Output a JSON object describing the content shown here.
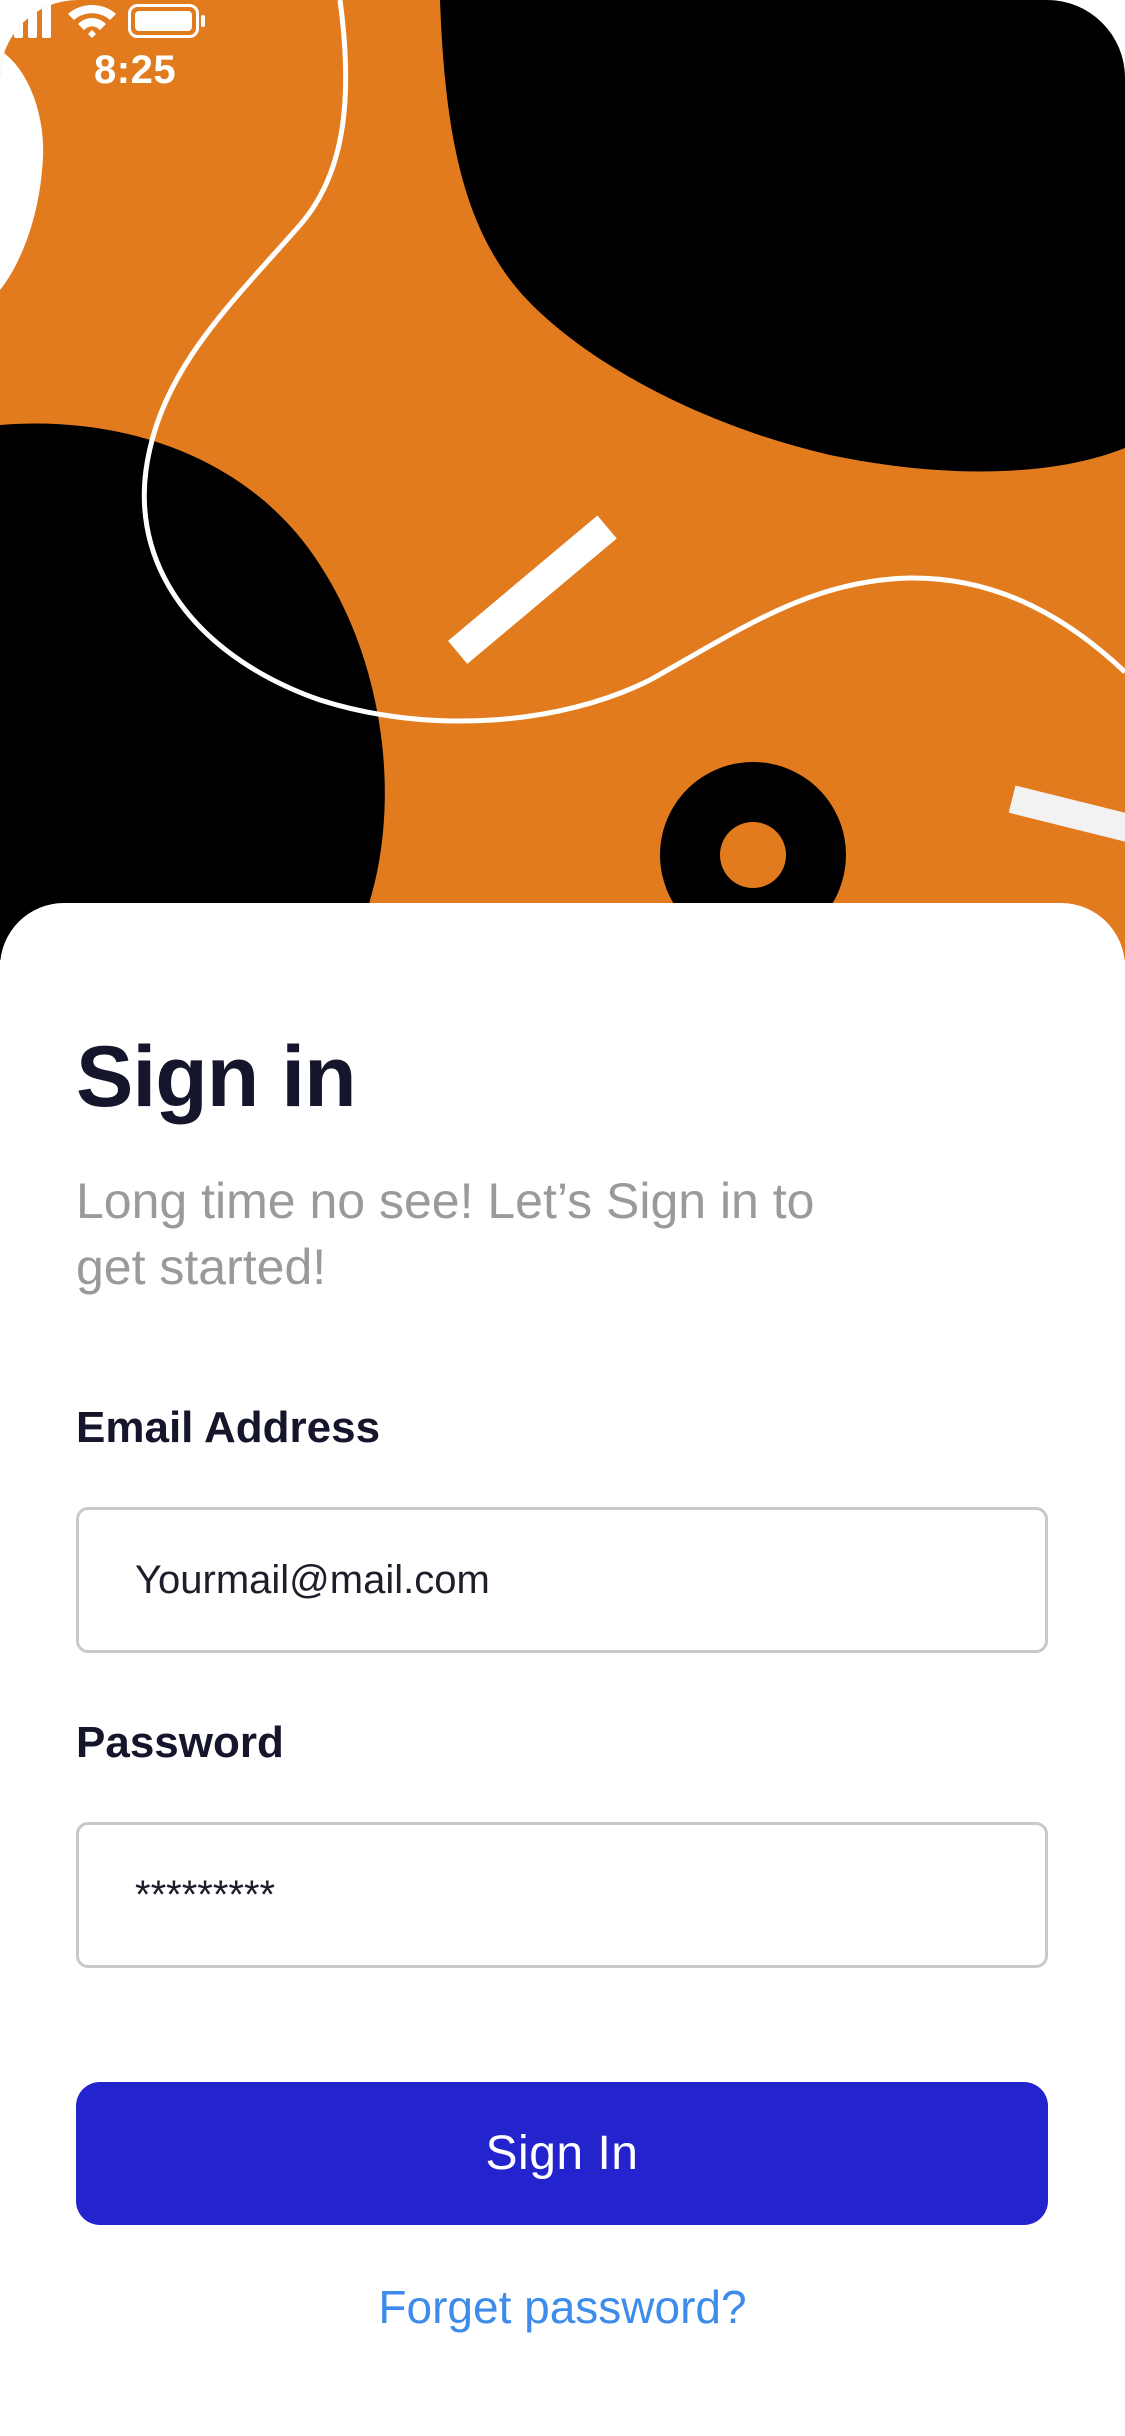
{
  "status_bar": {
    "time": "8:25",
    "icons": [
      "signal-icon",
      "wifi-icon",
      "battery-icon"
    ]
  },
  "hero": {
    "background_color": "#E27B1E",
    "shape_color": "#000000",
    "line_color": "#FFFFFF"
  },
  "signin": {
    "title": "Sign in",
    "subtitle": "Long time no see! Let’s Sign in to get started!",
    "email": {
      "label": "Email Address",
      "value": "Yourmail@mail.com"
    },
    "password": {
      "label": "Password",
      "value": "*********"
    },
    "submit_label": "Sign In",
    "forgot_label": "Forget password?"
  },
  "colors": {
    "accent": "#2424CF",
    "link": "#3D8BEA",
    "title": "#15162B",
    "subtitle": "#9A9A9A"
  }
}
